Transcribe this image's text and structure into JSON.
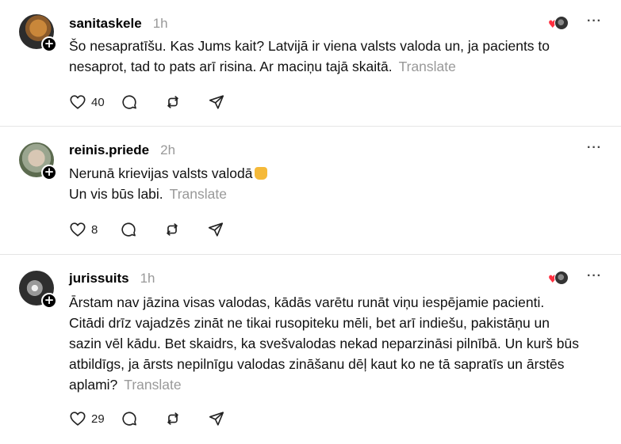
{
  "posts": [
    {
      "username": "sanitaskele",
      "time": "1h",
      "text_lines": [
        "Šo nesapratīšu. Kas Jums kait? Latvijā ir viena valsts valoda un, ja pacients to",
        "nesaprot, tad to pats arī risina. Ar maciņu tajā skaitā."
      ],
      "translate_label": "Translate",
      "likes": "40",
      "liked_by_author": true
    },
    {
      "username": "reinis.priede",
      "time": "2h",
      "text_lines": [
        "Nerunā krievijas valsts valodā",
        "Un vis būs labi."
      ],
      "emoji_name": "index-pointing-up-emoji",
      "translate_label": "Translate",
      "likes": "8",
      "liked_by_author": false
    },
    {
      "username": "jurissuits",
      "time": "1h",
      "text_lines": [
        "Ārstam nav jāzina visas valodas, kādās varētu runāt viņu iespējamie pacienti.",
        "Citādi drīz vajadzēs zināt ne tikai rusopiteku mēli, bet arī indiešu, pakistāņu un",
        "sazin vēl kādu. Bet skaidrs, ka svešvalodas nekad neparzināsi pilnībā. Un kurš būs",
        "atbildīgs, ja ārsts nepilnīgu valodas zināšanu dēļ kaut ko ne tā sapratīs un ārstēs",
        "aplami?"
      ],
      "translate_label": "Translate",
      "likes": "29",
      "liked_by_author": true
    }
  ],
  "icons": {
    "like": "heart-icon",
    "reply": "comment-icon",
    "repost": "repost-icon",
    "share": "share-icon",
    "more": "more-options-icon",
    "follow": "plus-icon"
  },
  "colors": {
    "accent_like": "#ff3040",
    "muted": "#999999"
  }
}
